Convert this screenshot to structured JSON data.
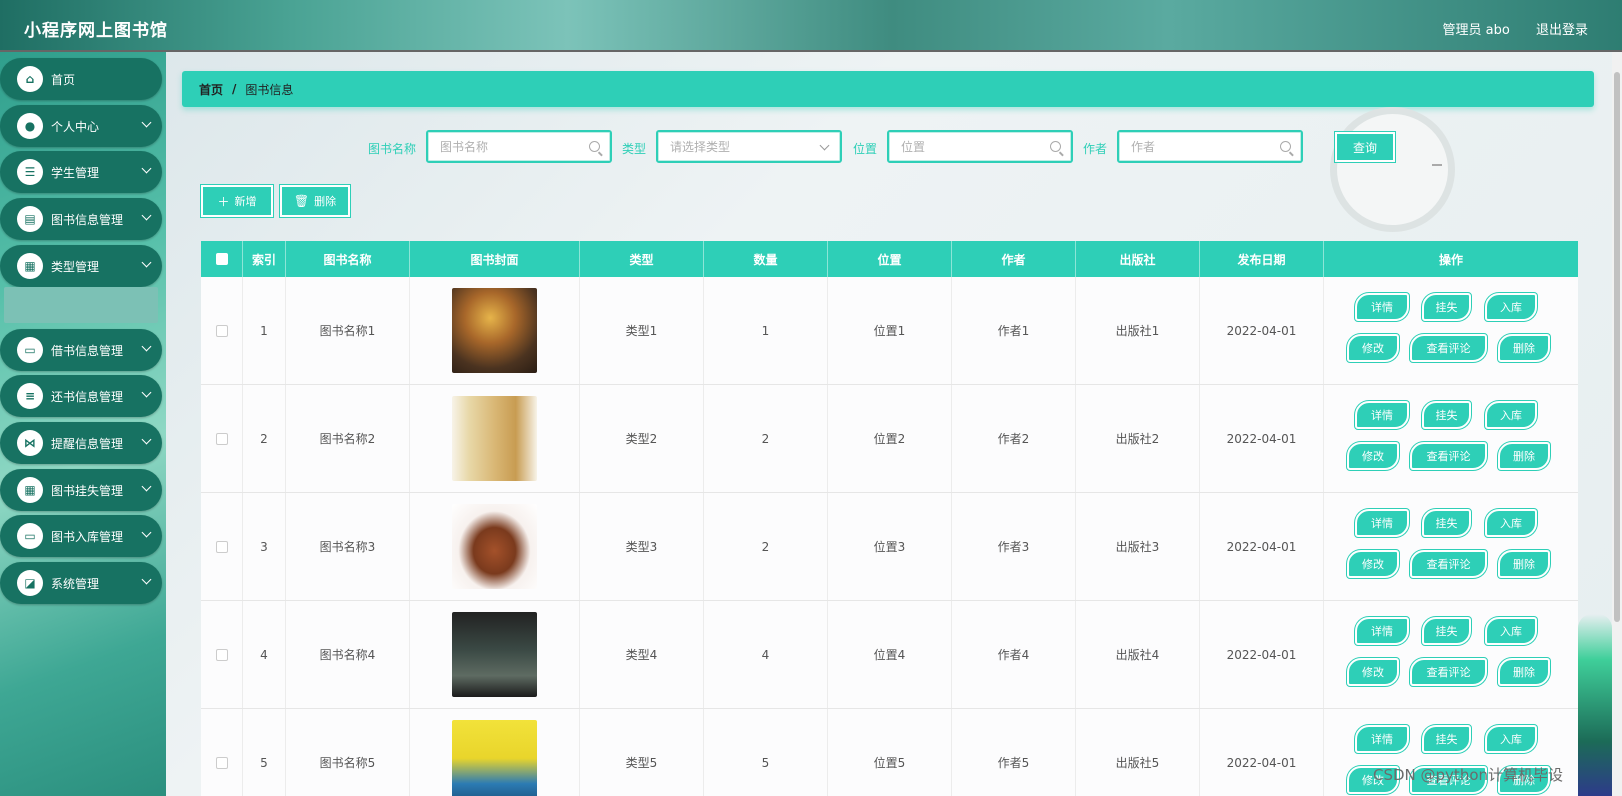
{
  "header": {
    "app_title": "小程序网上图书馆",
    "user_label": "管理员 abo",
    "logout_label": "退出登录"
  },
  "sidebar": {
    "items": [
      {
        "label": "首页",
        "icon": "home-icon",
        "glyph": "⌂",
        "has_arrow": false
      },
      {
        "label": "个人中心",
        "icon": "user-icon",
        "glyph": "●",
        "has_arrow": true
      },
      {
        "label": "学生管理",
        "icon": "sliders-icon",
        "glyph": "☰",
        "has_arrow": true
      },
      {
        "label": "图书信息管理",
        "icon": "clipboard-icon",
        "glyph": "▤",
        "has_arrow": true
      },
      {
        "label": "类型管理",
        "icon": "grid-icon",
        "glyph": "▦",
        "has_arrow": true
      },
      {
        "label": "借书信息管理",
        "icon": "monitor-icon",
        "glyph": "▭",
        "has_arrow": true
      },
      {
        "label": "还书信息管理",
        "icon": "list-icon",
        "glyph": "≡",
        "has_arrow": true
      },
      {
        "label": "提醒信息管理",
        "icon": "bowtie-icon",
        "glyph": "⋈",
        "has_arrow": true
      },
      {
        "label": "图书挂失管理",
        "icon": "grid-icon",
        "glyph": "▦",
        "has_arrow": true
      },
      {
        "label": "图书入库管理",
        "icon": "monitor-icon",
        "glyph": "▭",
        "has_arrow": true
      },
      {
        "label": "系统管理",
        "icon": "chart-icon",
        "glyph": "◪",
        "has_arrow": true
      }
    ]
  },
  "breadcrumb": {
    "home": "首页",
    "separator": "/",
    "current": "图书信息"
  },
  "search": {
    "name_label": "图书名称",
    "name_placeholder": "图书名称",
    "type_label": "类型",
    "type_placeholder": "请选择类型",
    "location_label": "位置",
    "location_placeholder": "位置",
    "author_label": "作者",
    "author_placeholder": "作者",
    "query_label": "查询"
  },
  "actions": {
    "add_label": "新增",
    "delete_label": "删除"
  },
  "table": {
    "headers": [
      "索引",
      "图书名称",
      "图书封面",
      "类型",
      "数量",
      "位置",
      "作者",
      "出版社",
      "发布日期",
      "操作"
    ],
    "rows": [
      {
        "index": "1",
        "name": "图书名称1",
        "type": "类型1",
        "qty": "1",
        "location": "位置1",
        "author": "作者1",
        "publisher": "出版社1",
        "date": "2022-04-01"
      },
      {
        "index": "2",
        "name": "图书名称2",
        "type": "类型2",
        "qty": "2",
        "location": "位置2",
        "author": "作者2",
        "publisher": "出版社2",
        "date": "2022-04-01"
      },
      {
        "index": "3",
        "name": "图书名称3",
        "type": "类型3",
        "qty": "2",
        "location": "位置3",
        "author": "作者3",
        "publisher": "出版社3",
        "date": "2022-04-01"
      },
      {
        "index": "4",
        "name": "图书名称4",
        "type": "类型4",
        "qty": "4",
        "location": "位置4",
        "author": "作者4",
        "publisher": "出版社4",
        "date": "2022-04-01"
      },
      {
        "index": "5",
        "name": "图书名称5",
        "type": "类型5",
        "qty": "5",
        "location": "位置5",
        "author": "作者5",
        "publisher": "出版社5",
        "date": "2022-04-01"
      }
    ],
    "row_actions": {
      "detail": "详情",
      "report_loss": "挂失",
      "stock_in": "入库",
      "edit": "修改",
      "view_comments": "查看评论",
      "delete": "删除"
    }
  },
  "watermark": "CSDN @python计算机毕设",
  "colors": {
    "accent": "#2ecfb7",
    "sidebar_item": "#177262"
  }
}
